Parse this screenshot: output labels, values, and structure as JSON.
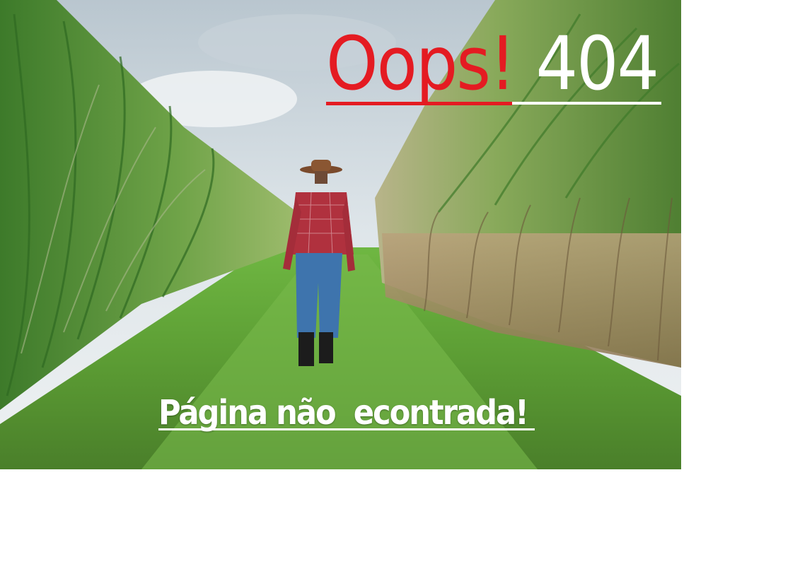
{
  "error": {
    "oops_text": "Oops!",
    "code_text": "404",
    "message": "Página não  econtrada!"
  },
  "colors": {
    "oops": "#e41b22",
    "code": "#ffffff",
    "message": "#ffffff",
    "page_background": "#ffffff"
  }
}
